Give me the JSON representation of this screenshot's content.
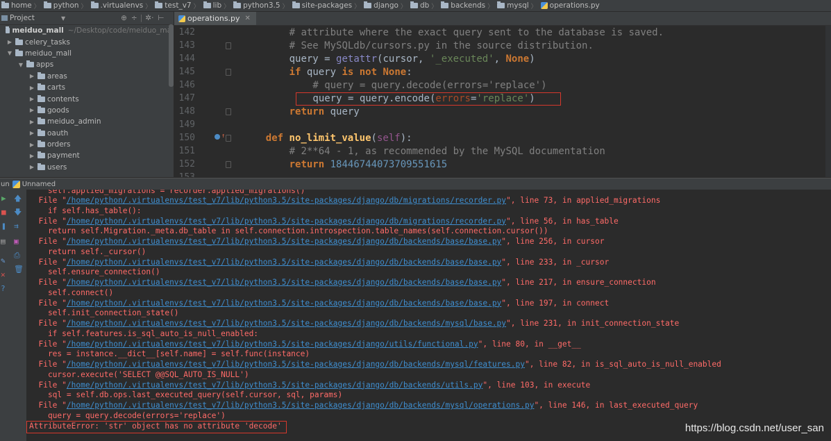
{
  "breadcrumb": [
    "home",
    "python",
    ".virtualenvs",
    "test_v7",
    "lib",
    "python3.5",
    "site-packages",
    "django",
    "db",
    "backends",
    "mysql",
    "operations.py"
  ],
  "project_panel": {
    "title": "Project",
    "root_name": "meiduo_mall",
    "root_path": "~/Desktop/code/meiduo_mal",
    "items": [
      {
        "label": "celery_tasks",
        "depth": 1,
        "arrow": "collapsed"
      },
      {
        "label": "meiduo_mall",
        "depth": 1,
        "arrow": "expanded"
      },
      {
        "label": "apps",
        "depth": 2,
        "arrow": "expanded"
      },
      {
        "label": "areas",
        "depth": 3,
        "arrow": "collapsed"
      },
      {
        "label": "carts",
        "depth": 3,
        "arrow": "collapsed"
      },
      {
        "label": "contents",
        "depth": 3,
        "arrow": "collapsed"
      },
      {
        "label": "goods",
        "depth": 3,
        "arrow": "collapsed"
      },
      {
        "label": "meiduo_admin",
        "depth": 3,
        "arrow": "collapsed"
      },
      {
        "label": "oauth",
        "depth": 3,
        "arrow": "collapsed"
      },
      {
        "label": "orders",
        "depth": 3,
        "arrow": "collapsed"
      },
      {
        "label": "payment",
        "depth": 3,
        "arrow": "collapsed"
      },
      {
        "label": "users",
        "depth": 3,
        "arrow": "collapsed"
      }
    ]
  },
  "editor": {
    "tab": "operations.py",
    "lines": [
      {
        "n": "142",
        "indent": 8,
        "tokens": [
          [
            "c-com",
            "# attribute where the exact query sent to the database is saved."
          ]
        ]
      },
      {
        "n": "143",
        "indent": 8,
        "tokens": [
          [
            "c-com",
            "# See MySQLdb/cursors.py in the source distribution."
          ]
        ]
      },
      {
        "n": "144",
        "indent": 8,
        "tokens": [
          [
            "c-plain",
            "query = "
          ],
          [
            "c-bi",
            "getattr"
          ],
          [
            "c-plain",
            "(cursor, "
          ],
          [
            "c-str",
            "'_executed'"
          ],
          [
            "c-plain",
            ", "
          ],
          [
            "c-kw",
            "None"
          ],
          [
            "c-plain",
            ")"
          ]
        ]
      },
      {
        "n": "145",
        "indent": 8,
        "tokens": [
          [
            "c-kw",
            "if "
          ],
          [
            "c-plain",
            "query "
          ],
          [
            "c-kw",
            "is not None"
          ],
          [
            "c-plain",
            ":"
          ]
        ]
      },
      {
        "n": "146",
        "indent": 12,
        "tokens": [
          [
            "c-com",
            "# query = query.decode(errors='replace')"
          ]
        ]
      },
      {
        "n": "147",
        "indent": 12,
        "tokens": [
          [
            "c-plain",
            "query = query.encode("
          ],
          [
            "c-param",
            "errors"
          ],
          [
            "c-plain",
            "="
          ],
          [
            "c-str",
            "'replace'"
          ],
          [
            "c-plain",
            ")"
          ]
        ]
      },
      {
        "n": "148",
        "indent": 8,
        "tokens": [
          [
            "c-kw",
            "return "
          ],
          [
            "c-plain",
            "query"
          ]
        ]
      },
      {
        "n": "149",
        "indent": 0,
        "tokens": []
      },
      {
        "n": "150",
        "indent": 4,
        "tokens": [
          [
            "c-kw",
            "def "
          ],
          [
            "c-fn",
            "no_limit_value"
          ],
          [
            "c-plain",
            "("
          ],
          [
            "c-self",
            "self"
          ],
          [
            "c-plain",
            "):"
          ]
        ]
      },
      {
        "n": "151",
        "indent": 8,
        "tokens": [
          [
            "c-com",
            "# 2**64 - 1, as recommended by the MySQL documentation"
          ]
        ]
      },
      {
        "n": "152",
        "indent": 8,
        "tokens": [
          [
            "c-kw",
            "return "
          ],
          [
            "c-num",
            "18446744073709551615"
          ]
        ]
      },
      {
        "n": "153",
        "indent": 0,
        "tokens": []
      }
    ]
  },
  "run_panel": {
    "prefix": "un",
    "name": "Unnamed"
  },
  "console": {
    "lines": [
      {
        "partial": true,
        "text": "    self.applied_migrations = recorder.applied_migrations()"
      },
      {
        "file": "/home/python/.virtualenvs/test_v7/lib/python3.5/site-packages/django/db/migrations/recorder.py",
        "rest": "\", line 73, in applied_migrations"
      },
      {
        "text": "    if self.has_table():"
      },
      {
        "file": "/home/python/.virtualenvs/test_v7/lib/python3.5/site-packages/django/db/migrations/recorder.py",
        "rest": "\", line 56, in has_table"
      },
      {
        "text": "    return self.Migration._meta.db_table in self.connection.introspection.table_names(self.connection.cursor())"
      },
      {
        "file": "/home/python/.virtualenvs/test_v7/lib/python3.5/site-packages/django/db/backends/base/base.py",
        "rest": "\", line 256, in cursor"
      },
      {
        "text": "    return self._cursor()"
      },
      {
        "file": "/home/python/.virtualenvs/test_v7/lib/python3.5/site-packages/django/db/backends/base/base.py",
        "rest": "\", line 233, in _cursor"
      },
      {
        "text": "    self.ensure_connection()"
      },
      {
        "file": "/home/python/.virtualenvs/test_v7/lib/python3.5/site-packages/django/db/backends/base/base.py",
        "rest": "\", line 217, in ensure_connection"
      },
      {
        "text": "    self.connect()"
      },
      {
        "file": "/home/python/.virtualenvs/test_v7/lib/python3.5/site-packages/django/db/backends/base/base.py",
        "rest": "\", line 197, in connect"
      },
      {
        "text": "    self.init_connection_state()"
      },
      {
        "file": "/home/python/.virtualenvs/test_v7/lib/python3.5/site-packages/django/db/backends/mysql/base.py",
        "rest": "\", line 231, in init_connection_state"
      },
      {
        "text": "    if self.features.is_sql_auto_is_null_enabled:"
      },
      {
        "file": "/home/python/.virtualenvs/test_v7/lib/python3.5/site-packages/django/utils/functional.py",
        "rest": "\", line 80, in __get__"
      },
      {
        "text": "    res = instance.__dict__[self.name] = self.func(instance)"
      },
      {
        "file": "/home/python/.virtualenvs/test_v7/lib/python3.5/site-packages/django/db/backends/mysql/features.py",
        "rest": "\", line 82, in is_sql_auto_is_null_enabled"
      },
      {
        "text": "    cursor.execute('SELECT @@SQL_AUTO_IS_NULL')"
      },
      {
        "file": "/home/python/.virtualenvs/test_v7/lib/python3.5/site-packages/django/db/backends/utils.py",
        "rest": "\", line 103, in execute"
      },
      {
        "text": "    sql = self.db.ops.last_executed_query(self.cursor, sql, params)"
      },
      {
        "file": "/home/python/.virtualenvs/test_v7/lib/python3.5/site-packages/django/db/backends/mysql/operations.py",
        "rest": "\", line 146, in last_executed_query"
      },
      {
        "text": "    query = query.decode(errors='replace')"
      },
      {
        "text": "AttributeError: 'str' object has no attribute 'decode'"
      }
    ]
  },
  "watermark": "https://blog.csdn.net/user_san"
}
